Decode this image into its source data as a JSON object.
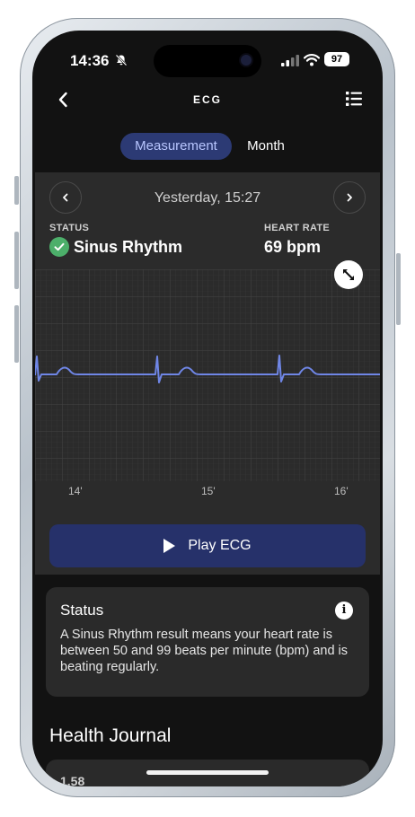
{
  "status_bar": {
    "time": "14:36",
    "battery": "97"
  },
  "nav": {
    "title": "ECG"
  },
  "segments": {
    "measurement": "Measurement",
    "month": "Month"
  },
  "record": {
    "date": "Yesterday, 15:27",
    "status_label": "STATUS",
    "status_value": "Sinus Rhythm",
    "heart_rate_label": "HEART RATE",
    "heart_rate_value": "69 bpm"
  },
  "chart_data": {
    "type": "line",
    "x_ticks": [
      "14'",
      "15'",
      "16'"
    ],
    "trace_color": "#6f86e6",
    "grid": true
  },
  "play": {
    "label": "Play ECG"
  },
  "status_card": {
    "title": "Status",
    "body": "A Sinus Rhythm result means your heart rate is between 50 and 99 beats per minute (bpm) and is beating regularly."
  },
  "journal": {
    "title": "Health Journal",
    "peek": "1.58"
  },
  "colors": {
    "accent": "#2c3a74",
    "check": "#4caf6a",
    "play_button": "#26316a"
  }
}
